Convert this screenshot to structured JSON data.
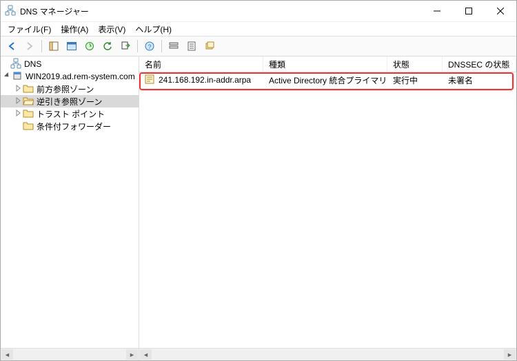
{
  "titlebar": {
    "title": "DNS マネージャー"
  },
  "menu": {
    "file": "ファイル(F)",
    "action": "操作(A)",
    "view": "表示(V)",
    "help": "ヘルプ(H)"
  },
  "tree": {
    "root": "DNS",
    "server": "WIN2019.ad.rem-system.com",
    "forward": "前方参照ゾーン",
    "reverse": "逆引き参照ゾーン",
    "trust": "トラスト ポイント",
    "cond": "条件付フォワーダー"
  },
  "columns": {
    "name": "名前",
    "type": "種類",
    "status": "状態",
    "dnssec": "DNSSEC の状態"
  },
  "rows": [
    {
      "name": "241.168.192.in-addr.arpa",
      "type": "Active Directory 統合プライマリ",
      "status": "実行中",
      "dnssec": "未署名"
    }
  ]
}
